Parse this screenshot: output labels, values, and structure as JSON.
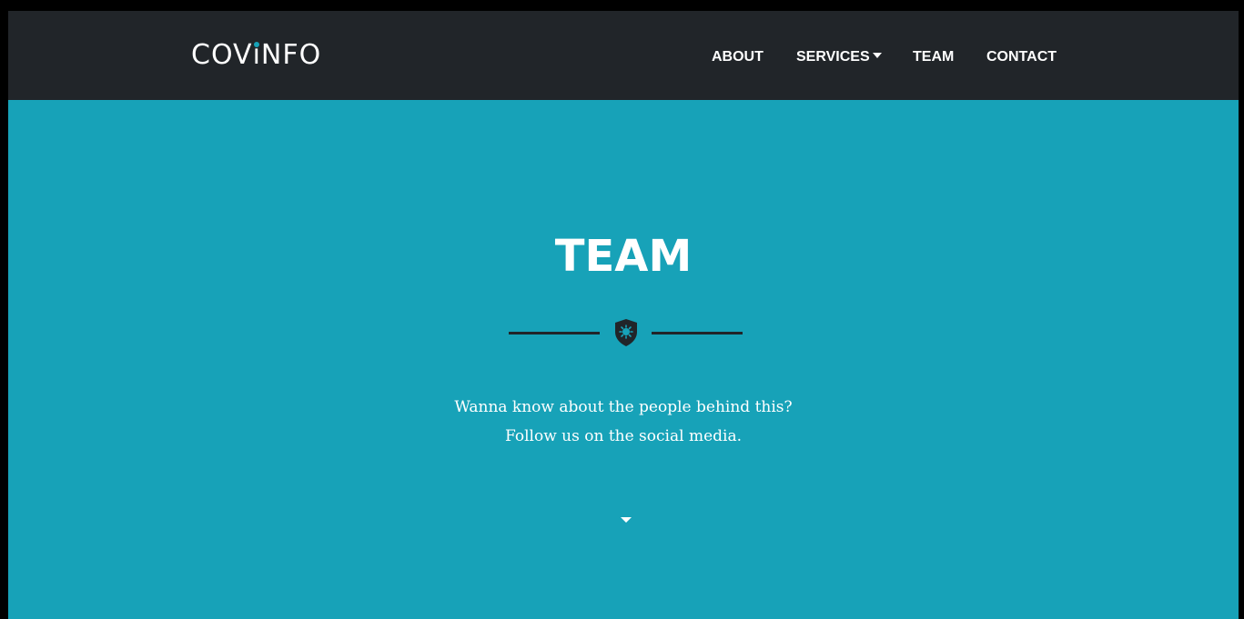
{
  "colors": {
    "navbar_bg": "#212529",
    "hero_bg": "#17a2b8",
    "text": "#ffffff",
    "accent": "#17a2b8",
    "divider": "#212529"
  },
  "navbar": {
    "brand": {
      "before": "COV",
      "i": "ı",
      "after": "NFO"
    },
    "links": [
      {
        "label": "ABOUT"
      },
      {
        "label": "SERVICES",
        "icon": "caret-down-icon"
      },
      {
        "label": "TEAM"
      },
      {
        "label": "CONTACT"
      }
    ]
  },
  "hero": {
    "title": "TEAM",
    "divider_icon": "virus-shield-icon",
    "lines": [
      "Wanna know about the people behind this?",
      "Follow us on the social media."
    ],
    "scroll_icon": "caret-down-icon"
  }
}
